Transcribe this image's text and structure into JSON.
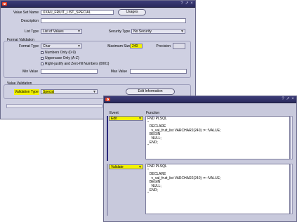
{
  "main_window": {
    "title": "",
    "value_set_name_label": "Value Set Name",
    "value_set_name": "XXAU_FRUIT_LIST_SPECIAL",
    "usages_button": "Usages",
    "description_label": "Description",
    "description": "",
    "list_type_label": "List Type",
    "list_type": "List of Values",
    "security_type_label": "Security Type",
    "security_type": "No Security",
    "format_validation": {
      "title": "Format Validation",
      "format_type_label": "Format Type",
      "format_type": "Char",
      "maximum_size_label": "Maximum Size",
      "maximum_size": "240",
      "precision_label": "Precision",
      "precision": "",
      "numbers_only_label": "Numbers Only (0-9)",
      "uppercase_only_label": "Uppercase Only (A-Z)",
      "right_justify_label": "Right-justify and Zero-fill Numbers (0001)",
      "min_value_label": "Min Value",
      "min_value": "",
      "max_value_label": "Max Value",
      "max_value": ""
    },
    "value_validation": {
      "title": "Value Validation",
      "validation_type_label": "Validation Type",
      "validation_type": "Special",
      "edit_information_button": "Edit Information"
    }
  },
  "special_window": {
    "title": "",
    "event_header": "Event",
    "function_header": "Function",
    "rows": [
      {
        "event": "Edit",
        "function": "FND PLSQL\n\"\n  DECLARE\n    v_val_fruit_list VARCHAR2(240) := :!VALUE;\n  BEGIN\n    NULL;\n  END;\n\""
      },
      {
        "event": "Validate",
        "function": "FND PLSQL\n\"\n  DECLARE\n    v_val_fruit_list VARCHAR2(240) := :!VALUE;\n  BEGIN\n    NULL;\n  END;\n\""
      }
    ]
  },
  "colors": {
    "window_bg": "#cfd0e2",
    "titlebar": "#2a2a5c",
    "highlight": "#f2f200",
    "oracle_red": "#e23c22"
  },
  "icons": {
    "window_logo": "oracle-logo-icon",
    "help": "question-icon",
    "minimize": "minimize-icon",
    "close": "close-icon"
  }
}
